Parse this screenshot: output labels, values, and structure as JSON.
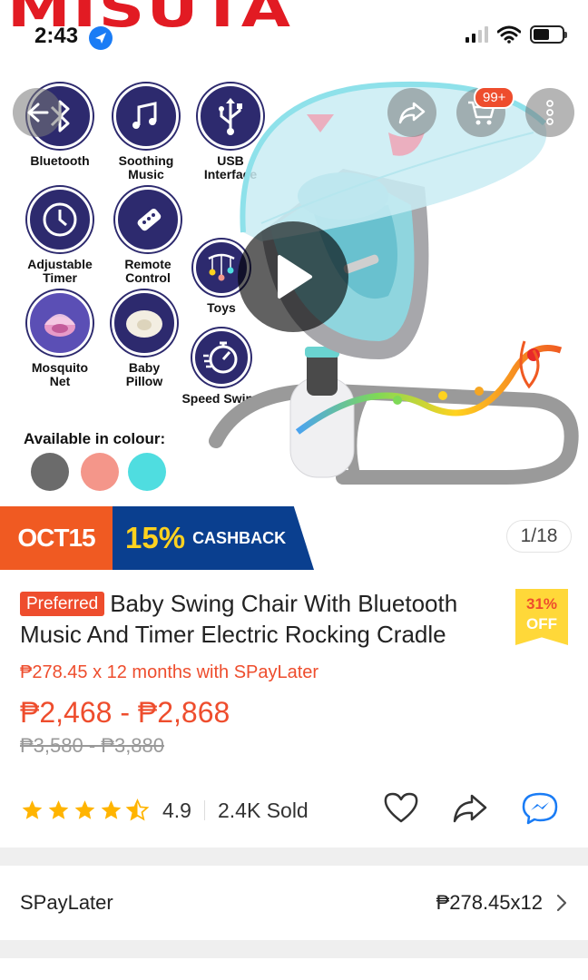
{
  "status_bar": {
    "time": "2:43"
  },
  "brand": {
    "logo_text": "MISUTA"
  },
  "nav": {
    "cart_badge": "99+"
  },
  "features": [
    {
      "label": "Bluetooth",
      "icon": "bluetooth-icon"
    },
    {
      "label": "Soothing Music",
      "icon": "music-note-icon"
    },
    {
      "label": "USB Interface",
      "icon": "usb-icon"
    },
    {
      "label": "Adjustable Timer",
      "icon": "clock-icon"
    },
    {
      "label": "Remote Control",
      "icon": "remote-control-icon"
    },
    {
      "label": "Toys",
      "icon": "mobile-toy-icon"
    },
    {
      "label": "Mosquito Net",
      "icon": "mosquito-net-icon"
    },
    {
      "label": "Baby Pillow",
      "icon": "pillow-icon"
    },
    {
      "label": "Speed Swing",
      "icon": "speed-icon"
    }
  ],
  "colours": {
    "label": "Available in colour:",
    "swatches": [
      "#6b6b6b",
      "#f4968a",
      "#4fdde0"
    ]
  },
  "promo": {
    "date": "OCT15",
    "percent": "15%",
    "text": "CASHBACK"
  },
  "gallery": {
    "counter": "1/18"
  },
  "product": {
    "badge": "Preferred",
    "title": "Baby Swing Chair With Bluetooth Music And Timer Electric Rocking Cradle",
    "discount_pct": "31%",
    "discount_off": "OFF",
    "installment": "₱278.45 x 12 months with SPayLater",
    "price": "₱2,468 - ₱2,868",
    "original_price": "₱3,580 - ₱3,880",
    "rating": "4.9",
    "rating_stars": 4.5,
    "sold": "2.4K Sold"
  },
  "spaylater": {
    "label": "SPayLater",
    "value": "₱278.45x12"
  },
  "colors": {
    "accent": "#ee4d2d",
    "promo_blue": "#0a3f8f",
    "promo_orange": "#f05a22",
    "star": "#ffb400"
  }
}
